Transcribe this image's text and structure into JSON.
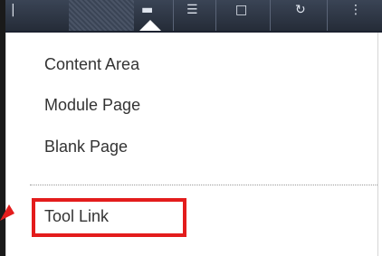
{
  "toolbar": {
    "icons": [
      "lines-icon",
      "hatch-panel",
      "dropdown-trigger-icon",
      "list-icon",
      "file-icon",
      "refresh-icon",
      "more-icon"
    ]
  },
  "menu": {
    "items": [
      {
        "label": "Content Area"
      },
      {
        "label": "Module Page"
      },
      {
        "label": "Blank Page"
      },
      {
        "label": "Tool Link"
      }
    ]
  },
  "annotation": {
    "highlight_color": "#e31c1c",
    "highlighted_item": "Tool Link"
  }
}
